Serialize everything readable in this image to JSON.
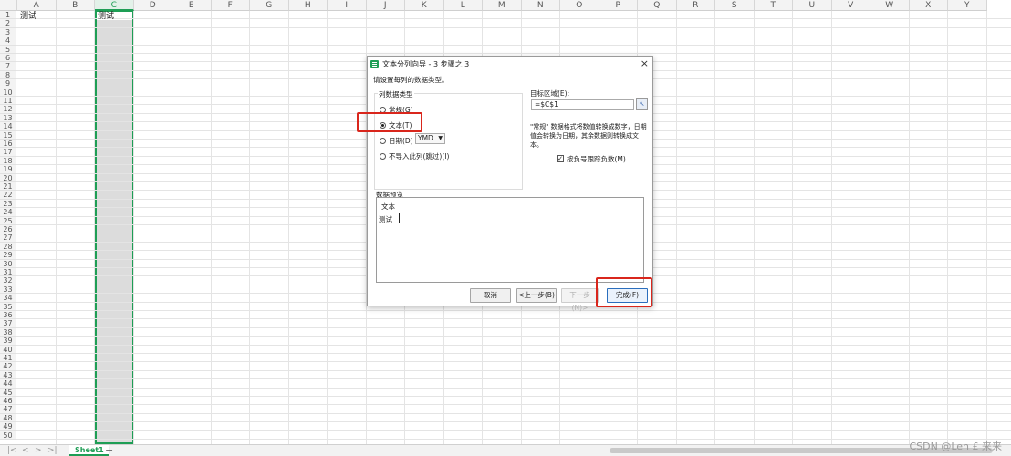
{
  "spreadsheet": {
    "columns": [
      "A",
      "B",
      "C",
      "D",
      "E",
      "F",
      "G",
      "H",
      "I",
      "J",
      "K",
      "L",
      "M",
      "N",
      "O",
      "P",
      "Q",
      "R",
      "S",
      "T",
      "U",
      "V",
      "W",
      "X",
      "Y"
    ],
    "rows": [
      "1",
      "2",
      "3",
      "4",
      "5",
      "6",
      "7",
      "8",
      "9",
      "10",
      "11",
      "12",
      "13",
      "14",
      "15",
      "16",
      "17",
      "18",
      "19",
      "20",
      "21",
      "22",
      "23",
      "24",
      "25",
      "26",
      "27",
      "28",
      "29",
      "30",
      "31",
      "32",
      "33",
      "34",
      "35",
      "36",
      "37",
      "38",
      "39",
      "40",
      "41",
      "42",
      "43",
      "44",
      "45",
      "46",
      "47",
      "48",
      "49",
      "50"
    ],
    "cell_A1": "测试",
    "cell_C1": "测试",
    "selected_column": "C",
    "sheet_tab": "Sheet1",
    "add_sheet": "+"
  },
  "dialog": {
    "title": "文本分列向导 - 3 步骤之 3",
    "instruction": "请设置每列的数据类型。",
    "group_label": "列数据类型",
    "options": {
      "general": "常规(G)",
      "text": "文本(T)",
      "date": "日期(D)",
      "skip": "不导入此列(跳过)(I)"
    },
    "selected_option": "text",
    "date_format": "YMD",
    "target_label": "目标区域(E):",
    "target_value": "=$C$1",
    "description": "\"常规\" 数据格式将数值转换成数字，日期值会转换为日期，其余数据则转换成文本。",
    "checkbox_label": "按负号跟踪负数(M)",
    "checkbox_checked": true,
    "preview_label": "数据预览",
    "preview_header": "文本",
    "preview_value": "测试",
    "buttons": {
      "cancel": "取消",
      "back": "<上一步(B)",
      "next": "下一步(N)>",
      "finish": "完成(F)"
    },
    "close": "×"
  },
  "watermark": "CSDN @Len £ 来来",
  "colors": {
    "accent": "#1e9e55",
    "highlight": "#d9261c"
  }
}
